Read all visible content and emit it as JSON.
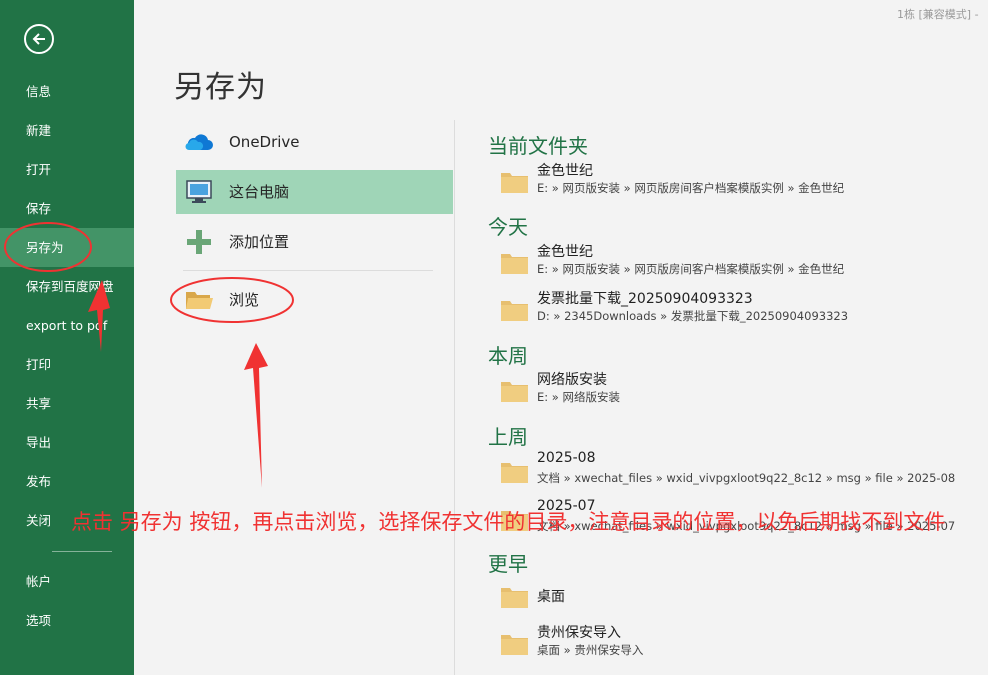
{
  "window": {
    "title": "1栋 [兼容模式] -"
  },
  "sidebar": {
    "back_icon": "back-arrow-icon",
    "items": [
      {
        "label": "信息"
      },
      {
        "label": "新建"
      },
      {
        "label": "打开"
      },
      {
        "label": "保存"
      },
      {
        "label": "另存为",
        "active": true
      },
      {
        "label": "保存到百度网盘"
      },
      {
        "label": "export to pdf"
      },
      {
        "label": "打印"
      },
      {
        "label": "共享"
      },
      {
        "label": "导出"
      },
      {
        "label": "发布"
      },
      {
        "label": "关闭"
      },
      {
        "label": "帐户"
      },
      {
        "label": "选项"
      }
    ],
    "colors": {
      "background": "#217346",
      "active": "#439467"
    }
  },
  "page": {
    "title": "另存为"
  },
  "locations": [
    {
      "label": "OneDrive",
      "icon": "onedrive-cloud-icon"
    },
    {
      "label": "这台电脑",
      "icon": "this-pc-icon",
      "selected": true
    },
    {
      "label": "添加位置",
      "icon": "plus-icon"
    },
    {
      "label": "浏览",
      "icon": "folder-open-icon"
    }
  ],
  "recent": {
    "current_folder": {
      "header": "当前文件夹",
      "items": [
        {
          "name": "金色世纪",
          "path": "E: » 网页版安装 » 网页版房间客户档案模版实例 » 金色世纪"
        }
      ]
    },
    "today": {
      "header": "今天",
      "items": [
        {
          "name": "金色世纪",
          "path": "E: » 网页版安装 » 网页版房间客户档案模版实例 » 金色世纪"
        },
        {
          "name": "发票批量下载_20250904093323",
          "path": "D: » 2345Downloads » 发票批量下载_20250904093323"
        }
      ]
    },
    "this_week": {
      "header": "本周",
      "items": [
        {
          "name": "网络版安装",
          "path": "E: » 网络版安装"
        }
      ]
    },
    "last_week": {
      "header": "上周",
      "items": [
        {
          "name": "2025-08",
          "path": "文档 » xwechat_files » wxid_vivpgxloot9q22_8c12 » msg » file » 2025-08"
        },
        {
          "name": "2025-07",
          "path": "文档 » xwechat_files » wxid_vivpgxloot9q22_8c12 » msg » file » 2025-07"
        }
      ]
    },
    "earlier": {
      "header": "更早",
      "items": [
        {
          "name": "桌面",
          "path": ""
        },
        {
          "name": "贵州保安导入",
          "path": "桌面 » 贵州保安导入"
        }
      ]
    }
  },
  "annotation": {
    "text": "点击 另存为 按钮，再点击浏览，选择保存文件的目录，注意目录的位置，以免后期找不到文件",
    "color": "#f03232"
  },
  "colors": {
    "accent_green": "#217346",
    "selected_location": "#9fd5b7",
    "folder": "#e7bf6f"
  }
}
